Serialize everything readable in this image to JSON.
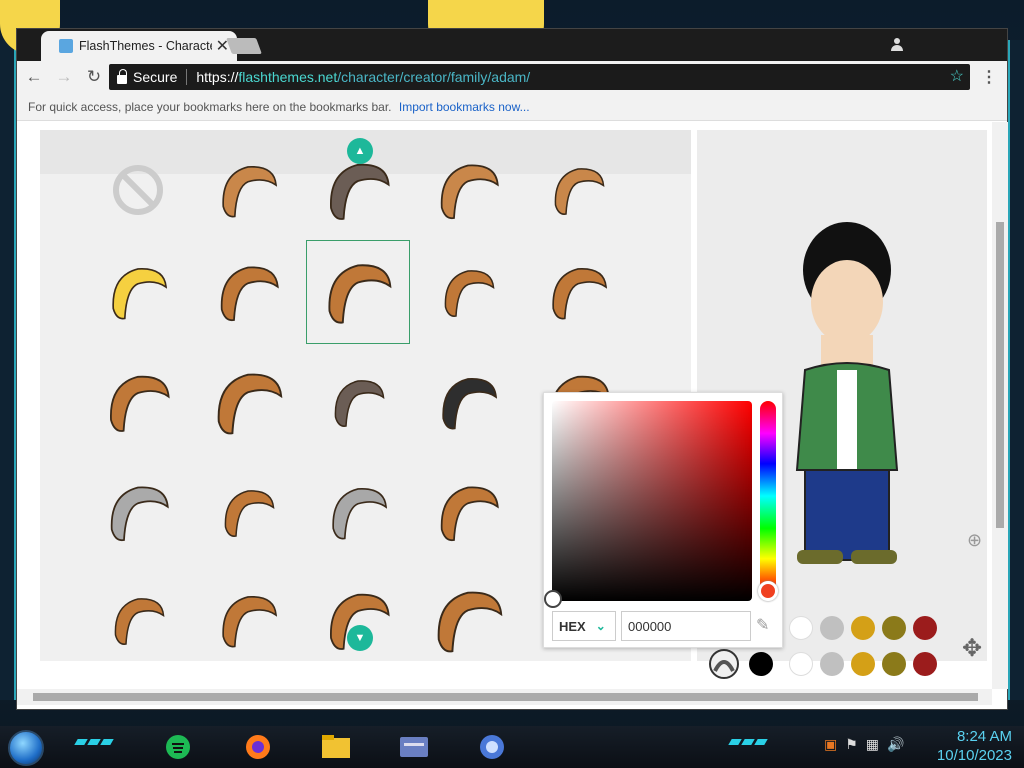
{
  "browser": {
    "tab_title": "FlashThemes - Character",
    "tab_close": "✕",
    "secure_label": "Secure",
    "url_scheme": "https://",
    "url_host": "flashthemes.net",
    "url_path": "/character/creator/family/adam/",
    "nav_back": "←",
    "nav_forward": "→",
    "nav_reload": "↻",
    "bookmark_star": "☆",
    "menu_icon": "⋮"
  },
  "bookmarks_bar": {
    "hint": "For quick access, place your bookmarks here on the bookmarks bar.",
    "import_link": "Import bookmarks now..."
  },
  "hair_grid": {
    "selected_index": 7,
    "items": [
      {
        "name": "none",
        "color": "#cccccc"
      },
      {
        "name": "hair-1",
        "color": "#c9874a"
      },
      {
        "name": "hair-2-cap",
        "color": "#6b5d55"
      },
      {
        "name": "hair-3",
        "color": "#c9874a"
      },
      {
        "name": "hair-4",
        "color": "#c9874a"
      },
      {
        "name": "hair-5",
        "color": "#f5d040"
      },
      {
        "name": "hair-6",
        "color": "#c07838"
      },
      {
        "name": "hair-7",
        "color": "#c07838"
      },
      {
        "name": "hair-8",
        "color": "#c07838"
      },
      {
        "name": "hair-9",
        "color": "#c07838"
      },
      {
        "name": "hair-10",
        "color": "#c07838"
      },
      {
        "name": "hair-11",
        "color": "#c07838"
      },
      {
        "name": "hair-12-cap",
        "color": "#6b5d55"
      },
      {
        "name": "hair-13",
        "color": "#2e2e2e"
      },
      {
        "name": "hair-14",
        "color": "#c07838"
      },
      {
        "name": "hair-15",
        "color": "#aaaaaa"
      },
      {
        "name": "hair-16",
        "color": "#c07838"
      },
      {
        "name": "hair-17",
        "color": "#a8a8a8"
      },
      {
        "name": "hair-18",
        "color": "#c07838"
      },
      {
        "name": "hair-19",
        "color": "#c07838"
      },
      {
        "name": "hair-20",
        "color": "#c07838"
      },
      {
        "name": "hair-21",
        "color": "#c07838"
      },
      {
        "name": "hair-22",
        "color": "#c07838"
      },
      {
        "name": "hair-23",
        "color": "#c07838"
      }
    ]
  },
  "color_picker": {
    "mode_label": "HEX",
    "hex_value": "000000",
    "eyedropper_icon": "✎"
  },
  "swatches": {
    "row1": [
      "#ffffff",
      "#c0c0c0",
      "#d4a017",
      "#8b7a1a",
      "#9b1c1c"
    ],
    "row2": [
      "#000000",
      "#ffffff",
      "#c0c0c0",
      "#d4a017",
      "#8b7a1a",
      "#9b1c1c"
    ]
  },
  "taskbar": {
    "time": "8:24 AM",
    "date": "10/10/2023"
  },
  "colors": {
    "accent": "#1db89a",
    "url_accent": "#4ad7d0",
    "selection_border": "#3a9e6a"
  }
}
